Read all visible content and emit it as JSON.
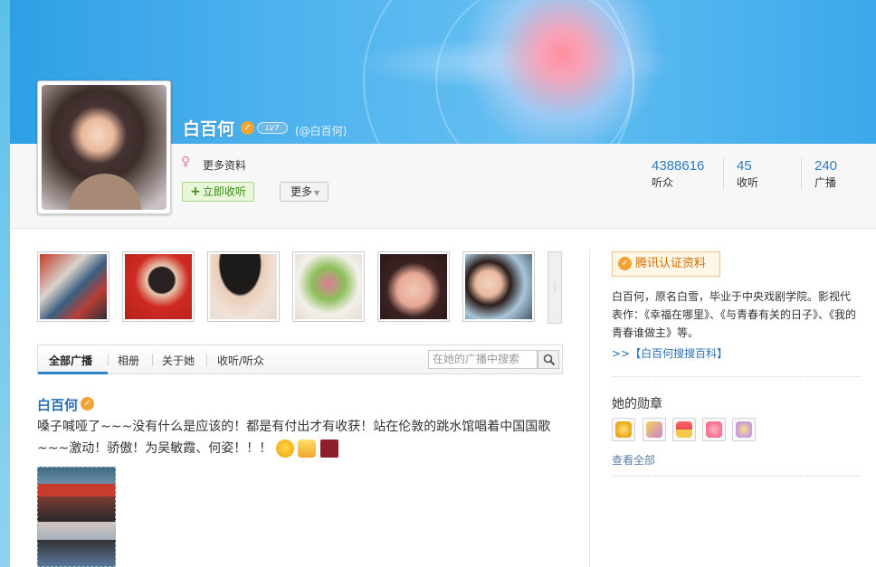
{
  "profile": {
    "name": "白百何",
    "level": "LV7",
    "handle": "(@白百何)",
    "more_info": "更多资料",
    "follow_button": "立即收听",
    "more_button": "更多"
  },
  "stats": [
    {
      "value": "4388616",
      "label": "听众"
    },
    {
      "value": "45",
      "label": "收听"
    },
    {
      "value": "240",
      "label": "广播"
    }
  ],
  "tabs": {
    "all": "全部广播",
    "album": "相册",
    "about": "关于她",
    "follow": "收听/听众",
    "search_placeholder": "在她的广播中搜索"
  },
  "post": {
    "author": "白百何",
    "text": "嗓子喊哑了~~~没有什么是应该的！都是有付出才有收获！站在伦敦的跳水馆唱着中国国歌~~~激动！骄傲！为吴敏霞、何姿！！！"
  },
  "sidebar": {
    "cert_label": "腾讯认证资料",
    "bio": "白百何，原名白雪，毕业于中央戏剧学院。影视代表作：《幸福在哪里》、《与青春有关的日子》、《我的青春谁做主》等。",
    "baike_link": ">>【白百何搜搜百科】",
    "medals_title": "她的勋章",
    "view_all": "查看全部"
  },
  "colors": {
    "accent": "#2a7cc0",
    "verify": "#f3a234",
    "follow_green": "#3a8a1a",
    "cert_orange": "#d36e00"
  }
}
